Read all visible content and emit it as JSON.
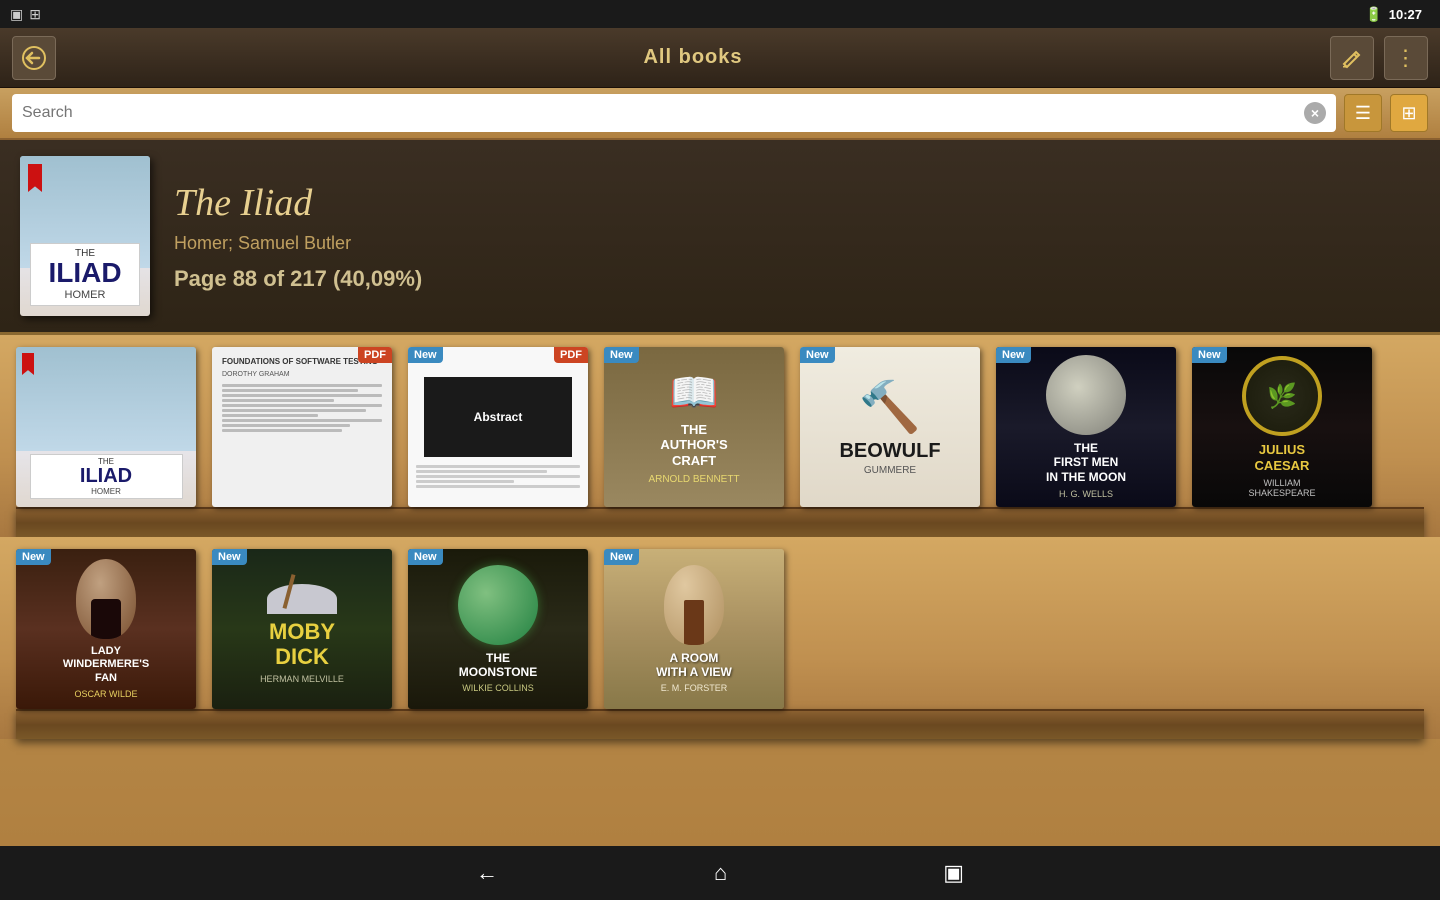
{
  "statusBar": {
    "time": "10:27",
    "batteryIcon": "🔋"
  },
  "toolbar": {
    "title": "All books",
    "backLabel": "⟲",
    "editLabel": "✏",
    "menuLabel": "⋮"
  },
  "search": {
    "placeholder": "Search",
    "clearLabel": "×"
  },
  "viewToggle": {
    "listLabel": "☰",
    "gridLabel": "⊞"
  },
  "featuredBook": {
    "title": "The Iliad",
    "author": "Homer; Samuel Butler",
    "progress": "Page 88 of 217 (40,09%)"
  },
  "shelf1": {
    "books": [
      {
        "id": "iliad",
        "title": "THE ILIAD",
        "subtitle": "THE",
        "author": "HOMER",
        "badge": "",
        "badgeType": "",
        "coverType": "iliad"
      },
      {
        "id": "pdf-doc",
        "title": "FOUNDATIONS OF SOFTWARE TESTING",
        "author": "",
        "badge": "PDF",
        "badgeType": "pdf",
        "coverType": "pdf"
      },
      {
        "id": "pdf-doc2",
        "title": "",
        "author": "",
        "badge": "New",
        "badgePdf": "PDF",
        "coverType": "pdf2"
      },
      {
        "id": "authors-craft",
        "title": "THE AUTHOR'S CRAFT",
        "author": "ARNOLD BENNETT",
        "badge": "New",
        "coverType": "authors-craft"
      },
      {
        "id": "beowulf",
        "title": "BEOWULF",
        "author": "GUMMERE",
        "badge": "New",
        "coverType": "beowulf"
      },
      {
        "id": "first-men",
        "title": "THE FIRST MEN IN THE MOON",
        "author": "H. G. WELLS",
        "badge": "New",
        "coverType": "first-men"
      },
      {
        "id": "julius",
        "title": "JULIUS CAESAR",
        "author": "WILLIAM SHAKESPEARE",
        "badge": "New",
        "coverType": "julius"
      }
    ]
  },
  "shelf2": {
    "books": [
      {
        "id": "lady",
        "title": "LADY WINDERMERE'S FAN",
        "author": "OSCAR WILDE",
        "badge": "New",
        "coverType": "lady"
      },
      {
        "id": "moby",
        "title": "MOBY DICK",
        "author": "HERMAN MELVILLE",
        "badge": "New",
        "coverType": "moby"
      },
      {
        "id": "moonstone",
        "title": "THE MOONSTONE",
        "author": "WILKIE COLLINS",
        "badge": "New",
        "coverType": "moonstone"
      },
      {
        "id": "room",
        "title": "A ROOM WITH A VIEW",
        "author": "E. M. FORSTER",
        "badge": "New",
        "coverType": "room"
      }
    ]
  },
  "navBar": {
    "backLabel": "←",
    "homeLabel": "⌂",
    "recentLabel": "▣"
  }
}
